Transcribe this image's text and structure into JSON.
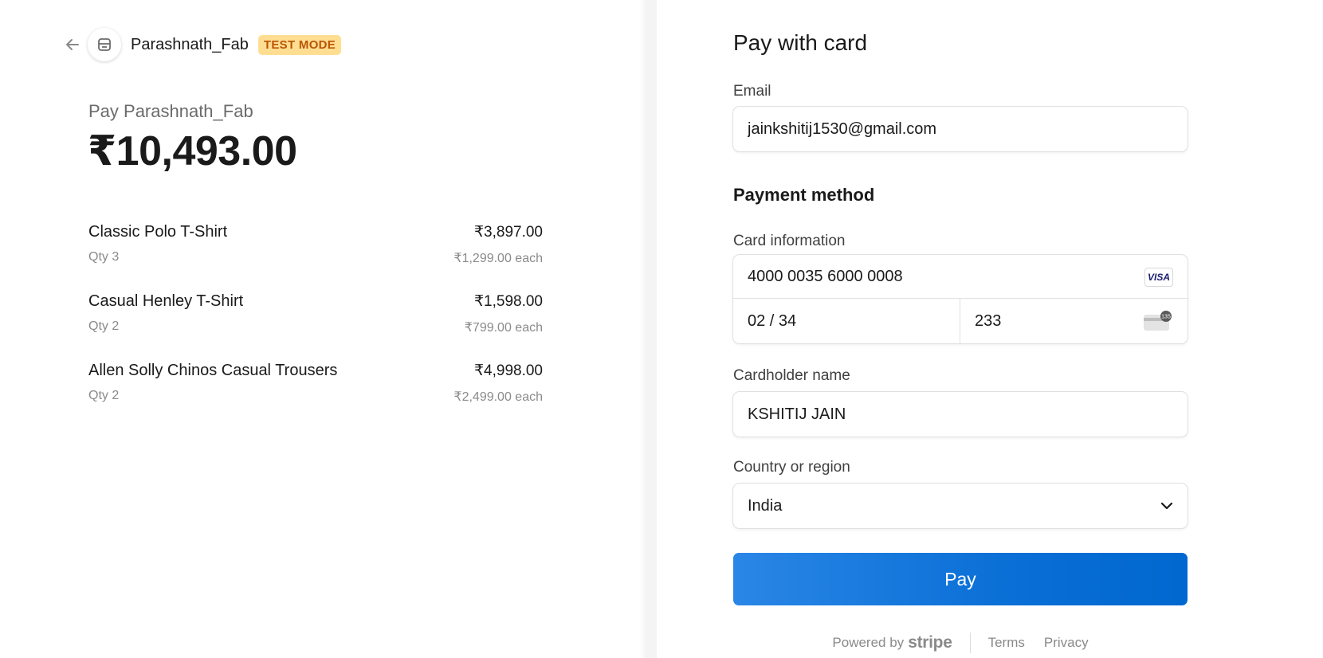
{
  "merchant": {
    "name": "Parashnath_Fab",
    "test_badge": "TEST MODE",
    "pay_to": "Pay Parashnath_Fab",
    "total": "₹10,493.00"
  },
  "line_items": [
    {
      "name": "Classic Polo T-Shirt",
      "qty": "Qty 3",
      "total": "₹3,897.00",
      "each": "₹1,299.00 each"
    },
    {
      "name": "Casual Henley T-Shirt",
      "qty": "Qty 2",
      "total": "₹1,598.00",
      "each": "₹799.00 each"
    },
    {
      "name": "Allen Solly Chinos Casual Trousers",
      "qty": "Qty 2",
      "total": "₹4,998.00",
      "each": "₹2,499.00 each"
    }
  ],
  "form": {
    "title": "Pay with card",
    "email_label": "Email",
    "email_value": "jainkshitij1530@gmail.com",
    "payment_method_title": "Payment method",
    "card_info_label": "Card information",
    "card_number": "4000 0035 6000 0008",
    "card_brand": "VISA",
    "expiry": "02 / 34",
    "cvc": "233",
    "cvc_badge": "135",
    "cardholder_label": "Cardholder name",
    "cardholder_value": "KSHITIJ JAIN",
    "country_label": "Country or region",
    "country_value": "India",
    "pay_button": "Pay"
  },
  "footer": {
    "powered_by": "Powered by",
    "brand": "stripe",
    "terms": "Terms",
    "privacy": "Privacy"
  },
  "colors": {
    "pay_button": "#0a6fd6",
    "test_badge_bg": "#ffde92",
    "test_badge_text": "#bb5504"
  }
}
